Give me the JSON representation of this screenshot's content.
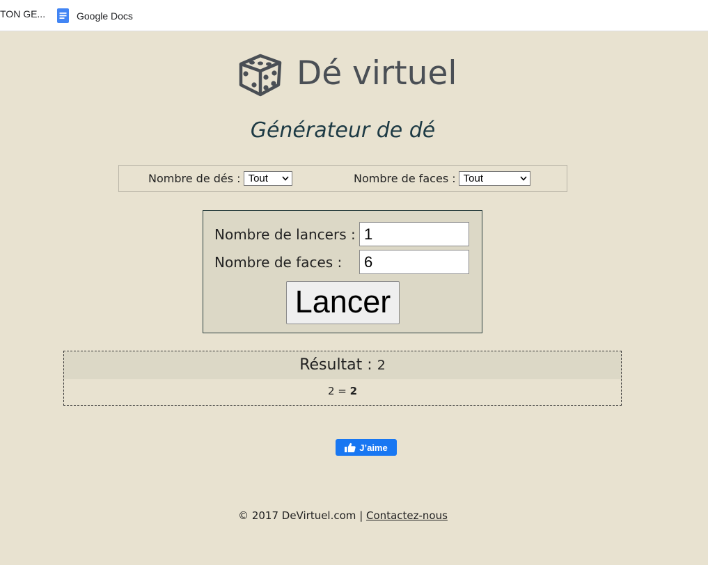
{
  "bookmarks": {
    "item1": "TON GE...",
    "item2": "Google Docs"
  },
  "header": {
    "title": "Dé virtuel",
    "subtitle": "Générateur de dé"
  },
  "filters": {
    "dice_count_label": "Nombre de dés :",
    "dice_count_value": "Tout",
    "faces_label": "Nombre de faces :",
    "faces_value": "Tout"
  },
  "form": {
    "rolls_label": "Nombre de lancers :",
    "rolls_value": "1",
    "faces_label": "Nombre de faces :",
    "faces_value": "6",
    "submit_label": "Lancer"
  },
  "result": {
    "label": "Résultat :",
    "value": "2",
    "detail_expr": "2 =",
    "detail_total": "2"
  },
  "social": {
    "like_label": "J’aime"
  },
  "footer": {
    "copyright": "© 2017 DeVirtuel.com",
    "separator": "|",
    "contact_label": "Contactez-nous"
  },
  "colors": {
    "page_background": "#e8e2d0",
    "panel_background": "#dcd8c6",
    "facebook_blue": "#1877f2",
    "subtitle_color": "#1d3a44"
  }
}
